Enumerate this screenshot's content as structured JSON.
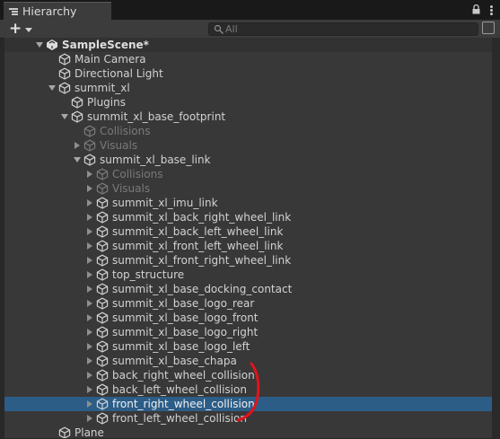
{
  "tab": {
    "title": "Hierarchy"
  },
  "toolbar": {
    "add_label": "+",
    "search_placeholder": "All"
  },
  "colors": {
    "selection": "#2c5d87",
    "annotation": "#e0141b",
    "panel": "#383838"
  },
  "rows": [
    {
      "label": "SampleScene*",
      "depth": 0,
      "arrow": "down",
      "icon": "unity-scene-icon",
      "state": "scene"
    },
    {
      "label": "Main Camera",
      "depth": 1,
      "arrow": "none",
      "icon": "cube-icon",
      "state": "normal"
    },
    {
      "label": "Directional Light",
      "depth": 1,
      "arrow": "none",
      "icon": "cube-icon",
      "state": "normal"
    },
    {
      "label": "summit_xl",
      "depth": 1,
      "arrow": "down",
      "icon": "cube-icon",
      "state": "normal"
    },
    {
      "label": "Plugins",
      "depth": 2,
      "arrow": "none",
      "icon": "cube-icon",
      "state": "normal"
    },
    {
      "label": "summit_xl_base_footprint",
      "depth": 2,
      "arrow": "down",
      "icon": "cube-icon",
      "state": "normal"
    },
    {
      "label": "Collisions",
      "depth": 3,
      "arrow": "none",
      "icon": "cube-icon",
      "state": "disabled"
    },
    {
      "label": "Visuals",
      "depth": 3,
      "arrow": "right",
      "icon": "cube-icon",
      "state": "disabled"
    },
    {
      "label": "summit_xl_base_link",
      "depth": 3,
      "arrow": "down",
      "icon": "cube-icon",
      "state": "normal"
    },
    {
      "label": "Collisions",
      "depth": 4,
      "arrow": "right",
      "icon": "cube-icon",
      "state": "disabled"
    },
    {
      "label": "Visuals",
      "depth": 4,
      "arrow": "right",
      "icon": "cube-icon",
      "state": "disabled"
    },
    {
      "label": "summit_xl_imu_link",
      "depth": 4,
      "arrow": "right",
      "icon": "cube-icon",
      "state": "normal"
    },
    {
      "label": "summit_xl_back_right_wheel_link",
      "depth": 4,
      "arrow": "right",
      "icon": "cube-icon",
      "state": "normal"
    },
    {
      "label": "summit_xl_back_left_wheel_link",
      "depth": 4,
      "arrow": "right",
      "icon": "cube-icon",
      "state": "normal"
    },
    {
      "label": "summit_xl_front_left_wheel_link",
      "depth": 4,
      "arrow": "right",
      "icon": "cube-icon",
      "state": "normal"
    },
    {
      "label": "summit_xl_front_right_wheel_link",
      "depth": 4,
      "arrow": "right",
      "icon": "cube-icon",
      "state": "normal"
    },
    {
      "label": "top_structure",
      "depth": 4,
      "arrow": "right",
      "icon": "cube-icon",
      "state": "normal"
    },
    {
      "label": "summit_xl_base_docking_contact",
      "depth": 4,
      "arrow": "right",
      "icon": "cube-icon",
      "state": "normal"
    },
    {
      "label": "summit_xl_base_logo_rear",
      "depth": 4,
      "arrow": "right",
      "icon": "cube-icon",
      "state": "normal"
    },
    {
      "label": "summit_xl_base_logo_front",
      "depth": 4,
      "arrow": "right",
      "icon": "cube-icon",
      "state": "normal"
    },
    {
      "label": "summit_xl_base_logo_right",
      "depth": 4,
      "arrow": "right",
      "icon": "cube-icon",
      "state": "normal"
    },
    {
      "label": "summit_xl_base_logo_left",
      "depth": 4,
      "arrow": "right",
      "icon": "cube-icon",
      "state": "normal"
    },
    {
      "label": "summit_xl_base_chapa",
      "depth": 4,
      "arrow": "right",
      "icon": "cube-icon",
      "state": "normal"
    },
    {
      "label": "back_right_wheel_collision",
      "depth": 4,
      "arrow": "right",
      "icon": "cube-icon",
      "state": "normal"
    },
    {
      "label": "back_left_wheel_collision",
      "depth": 4,
      "arrow": "right",
      "icon": "cube-icon",
      "state": "normal"
    },
    {
      "label": "front_right_wheel_collision",
      "depth": 4,
      "arrow": "right",
      "icon": "cube-icon",
      "state": "selected"
    },
    {
      "label": "front_left_wheel_collision",
      "depth": 4,
      "arrow": "right",
      "icon": "cube-icon",
      "state": "normal"
    },
    {
      "label": "Plane",
      "depth": 1,
      "arrow": "none",
      "icon": "cube-icon",
      "state": "normal"
    }
  ]
}
